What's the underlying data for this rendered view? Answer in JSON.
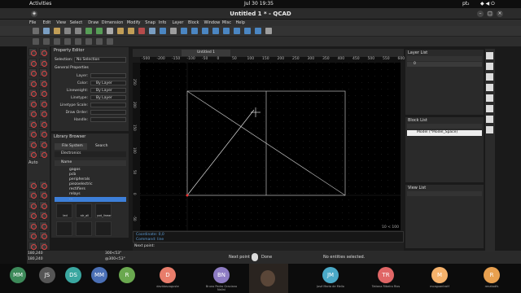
{
  "system": {
    "activities": "Activities",
    "clock": "Jul 30  19:35",
    "lang": "pt₂"
  },
  "window": {
    "title": "Untitled 1 * - QCAD"
  },
  "menu": [
    "File",
    "Edit",
    "View",
    "Select",
    "Draw",
    "Dimension",
    "Modify",
    "Snap",
    "Info",
    "Layer",
    "Block",
    "Window",
    "Misc",
    "Help"
  ],
  "property_editor": {
    "title": "Property Editor",
    "selection_label": "Selection:",
    "selection_value": "No Selection",
    "general": "General Properties",
    "rows": [
      {
        "label": "Layer:",
        "value": ""
      },
      {
        "label": "Color:",
        "value": "By Layer"
      },
      {
        "label": "Lineweight:",
        "value": "By Layer"
      },
      {
        "label": "Linetype:",
        "value": "By Layer"
      },
      {
        "label": "Linetype Scale:",
        "value": ""
      },
      {
        "label": "Draw Order:",
        "value": ""
      },
      {
        "label": "Handle:",
        "value": ""
      }
    ]
  },
  "library": {
    "title": "Library Browser",
    "tabs": [
      "File System",
      "Search"
    ],
    "path": "Electronics",
    "col": "Name",
    "folders": [
      "gagos",
      "pcb",
      "peripherals",
      "piezoelectric",
      "rectifiers",
      "relays",
      "..."
    ],
    "symbols": [
      "led",
      "str_all",
      "pot_linear"
    ]
  },
  "drawing": {
    "tab": "Untitled 1",
    "ruler_ticks": [
      "-500",
      "-200",
      "-150",
      "-100",
      "-50",
      "0",
      "50",
      "100",
      "150",
      "200",
      "250",
      "300",
      "350",
      "400",
      "450",
      "500",
      "550",
      "600"
    ],
    "ruler_left": [
      "250",
      "200",
      "150",
      "100",
      "50",
      "0",
      "-50"
    ],
    "grid_info": "10 < 100"
  },
  "command": {
    "history": [
      "Coordinate: 0,0",
      "Command: line"
    ],
    "prompt": "Next point:"
  },
  "status": {
    "coord1": "180,240",
    "coord2": "180,240",
    "coord3": "300<53°",
    "coord4": "@300<53°",
    "hint_left": "Next point",
    "hint_right": "Done",
    "selection": "No entities selected."
  },
  "layer_list": {
    "title": "Layer List",
    "layer0": "0"
  },
  "block_list": {
    "title": "Block List",
    "item": "Model (*Model_Space)"
  },
  "view_list": {
    "title": "View List"
  },
  "left_label": "Auto",
  "participants": [
    {
      "initials": "MM",
      "color": "#3d8a5a",
      "name": ""
    },
    {
      "initials": "JS",
      "color": "#555",
      "name": ""
    },
    {
      "initials": "DS",
      "color": "#3aa7a0",
      "name": ""
    },
    {
      "initials": "MM",
      "color": "#4a6fb5",
      "name": ""
    },
    {
      "initials": "R",
      "color": "#6aa84f",
      "name": ""
    },
    {
      "initials": "D",
      "color": "#e87d6b",
      "name": "davidoscaguste"
    },
    {
      "initials": "BN",
      "color": "#8e7cc3",
      "name": "Bruno Pedro Graciano Nalini"
    },
    {
      "initials": "JM",
      "color": "#4aa9c7",
      "name": "José Maria de Mello"
    },
    {
      "initials": "TR",
      "color": "#e06666",
      "name": "Tatiana Ribeiro Rios"
    },
    {
      "initials": "M",
      "color": "#f6b26b",
      "name": "mcaguantrotf"
    },
    {
      "initials": "R",
      "color": "#e8a04f",
      "name": "renatodfs"
    }
  ]
}
